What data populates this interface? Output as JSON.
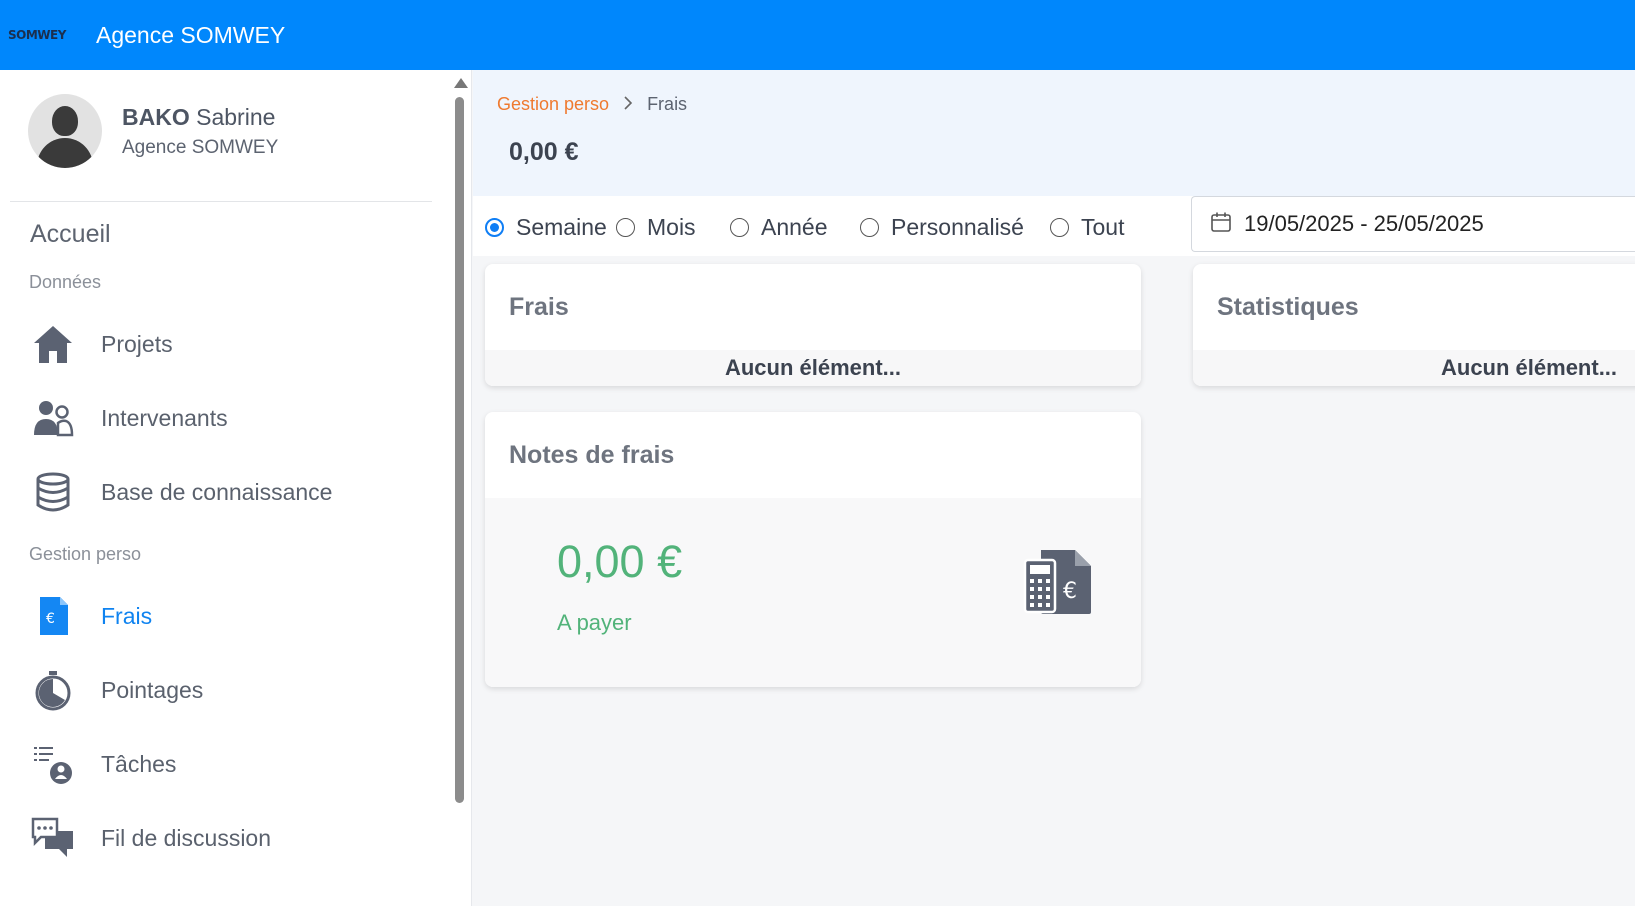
{
  "topbar": {
    "logo_text": "SOMWEY",
    "app_title": "Agence SOMWEY"
  },
  "user": {
    "last_name": "BAKO",
    "first_name": "Sabrine",
    "agency": "Agence SOMWEY"
  },
  "sidebar": {
    "home": "Accueil",
    "section_data": "Données",
    "section_perso": "Gestion perso",
    "items": [
      {
        "label": "Projets",
        "icon": "home-icon"
      },
      {
        "label": "Intervenants",
        "icon": "users-icon"
      },
      {
        "label": "Base de connaissance",
        "icon": "database-icon"
      },
      {
        "label": "Frais",
        "icon": "expense-document-icon",
        "active": true
      },
      {
        "label": "Pointages",
        "icon": "stopwatch-icon"
      },
      {
        "label": "Tâches",
        "icon": "task-list-user-icon"
      },
      {
        "label": "Fil de discussion",
        "icon": "chat-bubbles-icon"
      }
    ]
  },
  "breadcrumb": {
    "parent": "Gestion perso",
    "current": "Frais"
  },
  "total": "0,00 €",
  "filters": {
    "options": [
      "Semaine",
      "Mois",
      "Année",
      "Personnalisé",
      "Tout"
    ],
    "selected": "Semaine",
    "date_range": "19/05/2025 - 25/05/2025"
  },
  "cards": {
    "frais": {
      "title": "Frais",
      "empty": "Aucun élément..."
    },
    "statistiques": {
      "title": "Statistiques",
      "empty": "Aucun élément..."
    },
    "notes": {
      "title": "Notes de frais",
      "amount": "0,00 €",
      "status": "A payer"
    }
  },
  "colors": {
    "topbar": "#0087fc",
    "accent": "#0f83f0",
    "breadcrumb_link": "#ef7a2f",
    "amount_green": "#52b37a"
  }
}
